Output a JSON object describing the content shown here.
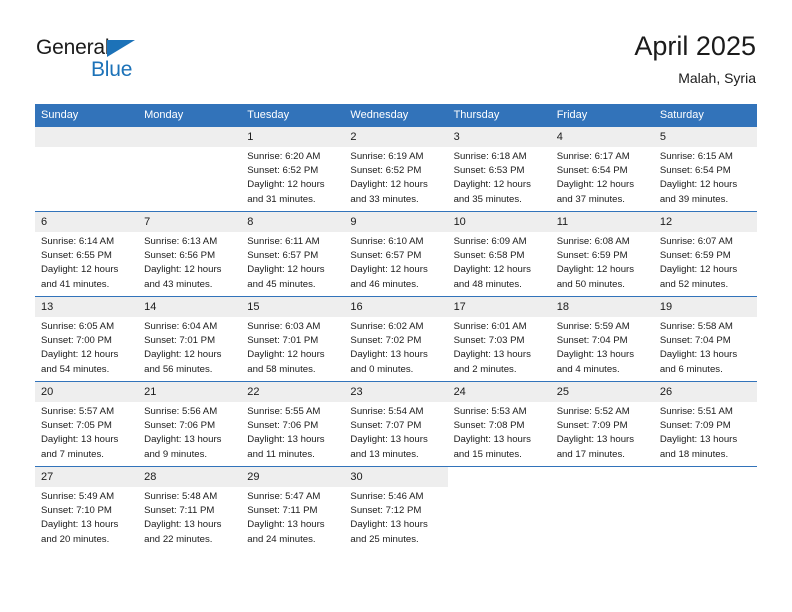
{
  "brand": {
    "name_top": "General",
    "name_bottom": "Blue",
    "accent_color": "#1c72b8"
  },
  "header": {
    "title": "April 2025",
    "subtitle": "Malah, Syria"
  },
  "theme": {
    "header_row_bg": "#3273ba",
    "daynum_bg": "#eeeeee",
    "text_color": "#1b1b1b"
  },
  "weekdays": [
    "Sunday",
    "Monday",
    "Tuesday",
    "Wednesday",
    "Thursday",
    "Friday",
    "Saturday"
  ],
  "weeks": [
    [
      {
        "day": "",
        "blank": true
      },
      {
        "day": "",
        "blank": true
      },
      {
        "day": "1",
        "sunrise": "Sunrise: 6:20 AM",
        "sunset": "Sunset: 6:52 PM",
        "daylight1": "Daylight: 12 hours",
        "daylight2": "and 31 minutes."
      },
      {
        "day": "2",
        "sunrise": "Sunrise: 6:19 AM",
        "sunset": "Sunset: 6:52 PM",
        "daylight1": "Daylight: 12 hours",
        "daylight2": "and 33 minutes."
      },
      {
        "day": "3",
        "sunrise": "Sunrise: 6:18 AM",
        "sunset": "Sunset: 6:53 PM",
        "daylight1": "Daylight: 12 hours",
        "daylight2": "and 35 minutes."
      },
      {
        "day": "4",
        "sunrise": "Sunrise: 6:17 AM",
        "sunset": "Sunset: 6:54 PM",
        "daylight1": "Daylight: 12 hours",
        "daylight2": "and 37 minutes."
      },
      {
        "day": "5",
        "sunrise": "Sunrise: 6:15 AM",
        "sunset": "Sunset: 6:54 PM",
        "daylight1": "Daylight: 12 hours",
        "daylight2": "and 39 minutes."
      }
    ],
    [
      {
        "day": "6",
        "sunrise": "Sunrise: 6:14 AM",
        "sunset": "Sunset: 6:55 PM",
        "daylight1": "Daylight: 12 hours",
        "daylight2": "and 41 minutes."
      },
      {
        "day": "7",
        "sunrise": "Sunrise: 6:13 AM",
        "sunset": "Sunset: 6:56 PM",
        "daylight1": "Daylight: 12 hours",
        "daylight2": "and 43 minutes."
      },
      {
        "day": "8",
        "sunrise": "Sunrise: 6:11 AM",
        "sunset": "Sunset: 6:57 PM",
        "daylight1": "Daylight: 12 hours",
        "daylight2": "and 45 minutes."
      },
      {
        "day": "9",
        "sunrise": "Sunrise: 6:10 AM",
        "sunset": "Sunset: 6:57 PM",
        "daylight1": "Daylight: 12 hours",
        "daylight2": "and 46 minutes."
      },
      {
        "day": "10",
        "sunrise": "Sunrise: 6:09 AM",
        "sunset": "Sunset: 6:58 PM",
        "daylight1": "Daylight: 12 hours",
        "daylight2": "and 48 minutes."
      },
      {
        "day": "11",
        "sunrise": "Sunrise: 6:08 AM",
        "sunset": "Sunset: 6:59 PM",
        "daylight1": "Daylight: 12 hours",
        "daylight2": "and 50 minutes."
      },
      {
        "day": "12",
        "sunrise": "Sunrise: 6:07 AM",
        "sunset": "Sunset: 6:59 PM",
        "daylight1": "Daylight: 12 hours",
        "daylight2": "and 52 minutes."
      }
    ],
    [
      {
        "day": "13",
        "sunrise": "Sunrise: 6:05 AM",
        "sunset": "Sunset: 7:00 PM",
        "daylight1": "Daylight: 12 hours",
        "daylight2": "and 54 minutes."
      },
      {
        "day": "14",
        "sunrise": "Sunrise: 6:04 AM",
        "sunset": "Sunset: 7:01 PM",
        "daylight1": "Daylight: 12 hours",
        "daylight2": "and 56 minutes."
      },
      {
        "day": "15",
        "sunrise": "Sunrise: 6:03 AM",
        "sunset": "Sunset: 7:01 PM",
        "daylight1": "Daylight: 12 hours",
        "daylight2": "and 58 minutes."
      },
      {
        "day": "16",
        "sunrise": "Sunrise: 6:02 AM",
        "sunset": "Sunset: 7:02 PM",
        "daylight1": "Daylight: 13 hours",
        "daylight2": "and 0 minutes."
      },
      {
        "day": "17",
        "sunrise": "Sunrise: 6:01 AM",
        "sunset": "Sunset: 7:03 PM",
        "daylight1": "Daylight: 13 hours",
        "daylight2": "and 2 minutes."
      },
      {
        "day": "18",
        "sunrise": "Sunrise: 5:59 AM",
        "sunset": "Sunset: 7:04 PM",
        "daylight1": "Daylight: 13 hours",
        "daylight2": "and 4 minutes."
      },
      {
        "day": "19",
        "sunrise": "Sunrise: 5:58 AM",
        "sunset": "Sunset: 7:04 PM",
        "daylight1": "Daylight: 13 hours",
        "daylight2": "and 6 minutes."
      }
    ],
    [
      {
        "day": "20",
        "sunrise": "Sunrise: 5:57 AM",
        "sunset": "Sunset: 7:05 PM",
        "daylight1": "Daylight: 13 hours",
        "daylight2": "and 7 minutes."
      },
      {
        "day": "21",
        "sunrise": "Sunrise: 5:56 AM",
        "sunset": "Sunset: 7:06 PM",
        "daylight1": "Daylight: 13 hours",
        "daylight2": "and 9 minutes."
      },
      {
        "day": "22",
        "sunrise": "Sunrise: 5:55 AM",
        "sunset": "Sunset: 7:06 PM",
        "daylight1": "Daylight: 13 hours",
        "daylight2": "and 11 minutes."
      },
      {
        "day": "23",
        "sunrise": "Sunrise: 5:54 AM",
        "sunset": "Sunset: 7:07 PM",
        "daylight1": "Daylight: 13 hours",
        "daylight2": "and 13 minutes."
      },
      {
        "day": "24",
        "sunrise": "Sunrise: 5:53 AM",
        "sunset": "Sunset: 7:08 PM",
        "daylight1": "Daylight: 13 hours",
        "daylight2": "and 15 minutes."
      },
      {
        "day": "25",
        "sunrise": "Sunrise: 5:52 AM",
        "sunset": "Sunset: 7:09 PM",
        "daylight1": "Daylight: 13 hours",
        "daylight2": "and 17 minutes."
      },
      {
        "day": "26",
        "sunrise": "Sunrise: 5:51 AM",
        "sunset": "Sunset: 7:09 PM",
        "daylight1": "Daylight: 13 hours",
        "daylight2": "and 18 minutes."
      }
    ],
    [
      {
        "day": "27",
        "sunrise": "Sunrise: 5:49 AM",
        "sunset": "Sunset: 7:10 PM",
        "daylight1": "Daylight: 13 hours",
        "daylight2": "and 20 minutes."
      },
      {
        "day": "28",
        "sunrise": "Sunrise: 5:48 AM",
        "sunset": "Sunset: 7:11 PM",
        "daylight1": "Daylight: 13 hours",
        "daylight2": "and 22 minutes."
      },
      {
        "day": "29",
        "sunrise": "Sunrise: 5:47 AM",
        "sunset": "Sunset: 7:11 PM",
        "daylight1": "Daylight: 13 hours",
        "daylight2": "and 24 minutes."
      },
      {
        "day": "30",
        "sunrise": "Sunrise: 5:46 AM",
        "sunset": "Sunset: 7:12 PM",
        "daylight1": "Daylight: 13 hours",
        "daylight2": "and 25 minutes."
      },
      {
        "day": "",
        "blank": true
      },
      {
        "day": "",
        "blank": true
      },
      {
        "day": "",
        "blank": true
      }
    ]
  ]
}
